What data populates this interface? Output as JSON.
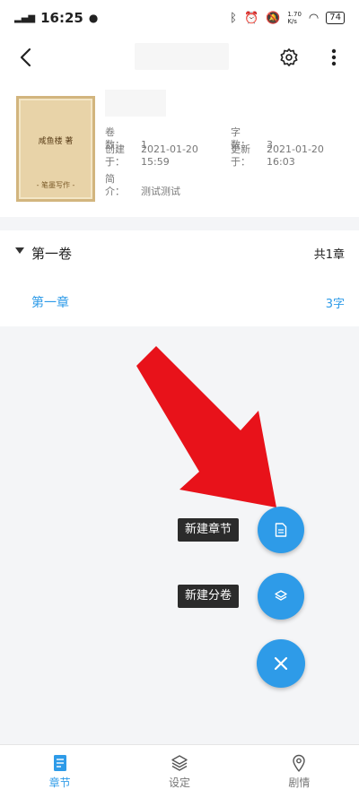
{
  "status": {
    "time": "16:25",
    "speed": "1.70\nK/s",
    "battery": "74"
  },
  "book": {
    "cover_title": "咸鱼楼 著",
    "cover_footer": "- 笔墨写作 -",
    "volumes_label": "卷　数：",
    "volumes_value": "1",
    "words_label": "字　数：",
    "words_value": "3",
    "created_label": "创建于：",
    "created_value": "2021-01-20\n15:59",
    "updated_label": "更新于：",
    "updated_value": "2021-01-20\n16:03",
    "intro_label": "简　介：",
    "intro_value": "测试测试"
  },
  "volume": {
    "title": "第一卷",
    "count": "共1章",
    "chapter_title": "第一章",
    "chapter_words": "3字"
  },
  "fab": {
    "new_chapter": "新建章节",
    "new_volume": "新建分卷"
  },
  "nav": {
    "chapters": "章节",
    "settings": "设定",
    "plot": "剧情"
  },
  "colors": {
    "accent": "#2e9be8",
    "arrow": "#e8121a"
  }
}
